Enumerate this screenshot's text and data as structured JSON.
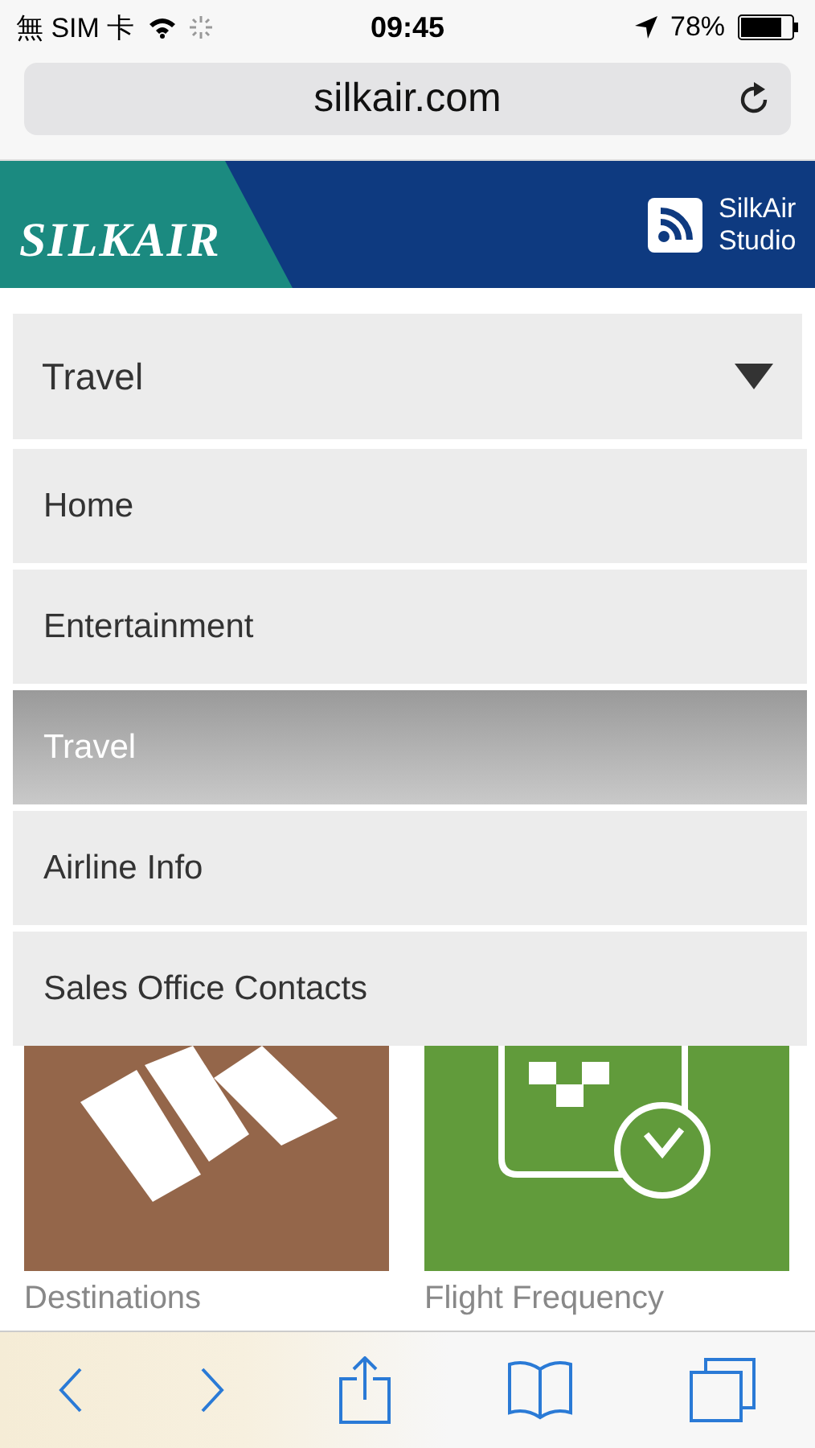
{
  "status_bar": {
    "carrier": "無 SIM 卡",
    "time": "09:45",
    "battery": "78%"
  },
  "address_bar": {
    "url": "silkair.com"
  },
  "header": {
    "logo": "SILKAIR",
    "studio_link": "SilkAir Studio"
  },
  "dropdown": {
    "value": "Travel"
  },
  "menu": [
    {
      "label": "Home",
      "selected": false
    },
    {
      "label": "Entertainment",
      "selected": false
    },
    {
      "label": "Travel",
      "selected": true
    },
    {
      "label": "Airline Info",
      "selected": false
    },
    {
      "label": "Sales Office Contacts",
      "selected": false
    }
  ],
  "tiles": [
    {
      "label": "Destinations",
      "kind": "destinations"
    },
    {
      "label": "Flight Frequency",
      "kind": "frequency"
    }
  ]
}
